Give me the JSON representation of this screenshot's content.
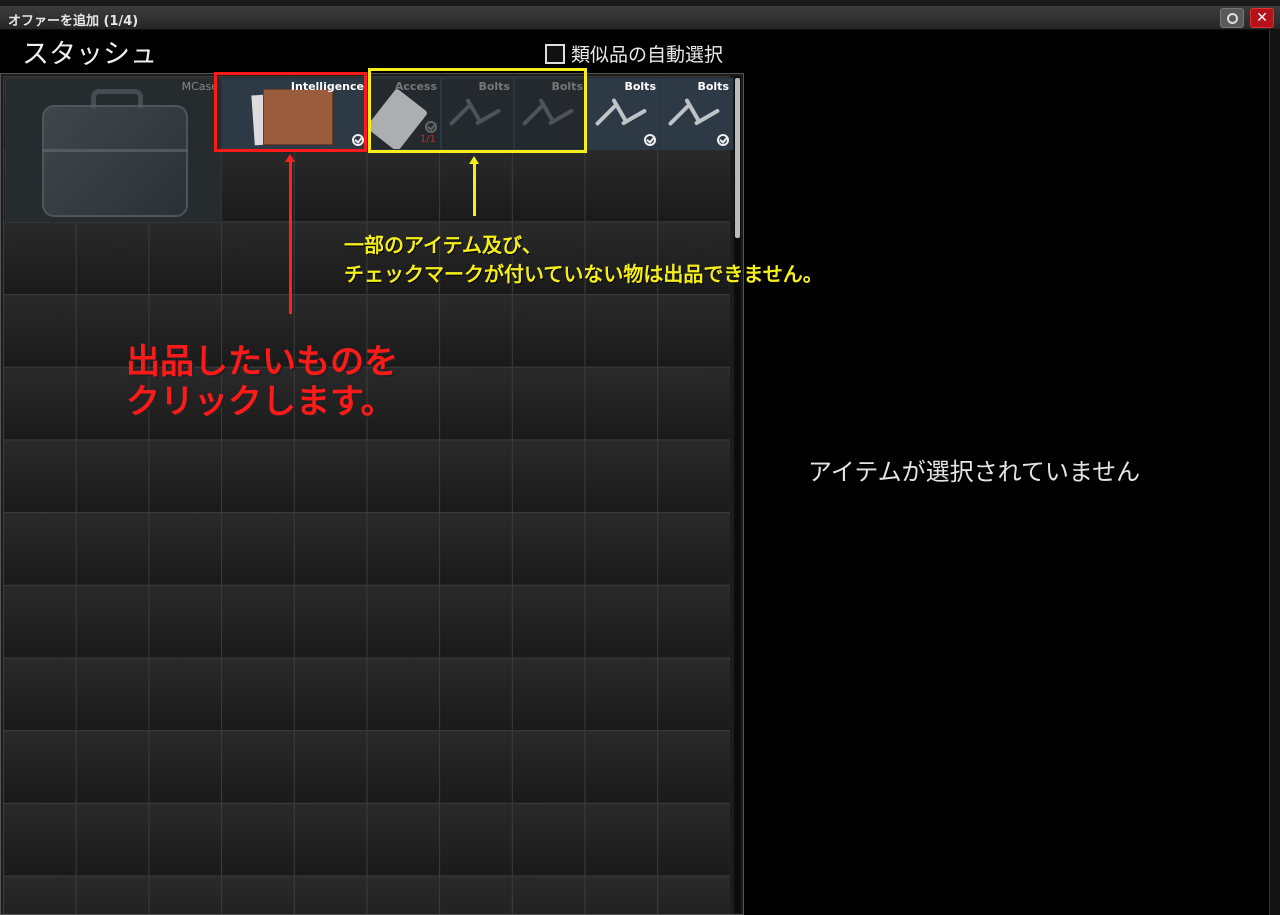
{
  "window": {
    "title": "オファーを追加 (1/4)",
    "restore_icon": "restore-icon",
    "close_icon": "close-icon",
    "close_glyph": "✕"
  },
  "header": {
    "stash_title": "スタッシュ",
    "auto_select_label": "類似品の自動選択",
    "auto_select_checked": false
  },
  "items": {
    "mcase": {
      "name": "MCase"
    },
    "intel": {
      "name": "Intelligence",
      "checked": true
    },
    "access": {
      "name": "Access",
      "uses": "1/1",
      "checked": false
    },
    "bolts1": {
      "name": "Bolts",
      "checked": false
    },
    "bolts2": {
      "name": "Bolts",
      "checked": false
    },
    "bolts3": {
      "name": "Bolts",
      "checked": true
    },
    "bolts4": {
      "name": "Bolts",
      "checked": true
    }
  },
  "annotations": {
    "yellow_line1": "一部のアイテム及び、",
    "yellow_line2": "チェックマークが付いていない物は出品できません。",
    "red_line1": "出品したいものを",
    "red_line2": "クリックします。",
    "red_color": "#ff1a1a",
    "yellow_color": "#f5ee1a"
  },
  "details": {
    "empty_message": "アイテムが選択されていません"
  }
}
